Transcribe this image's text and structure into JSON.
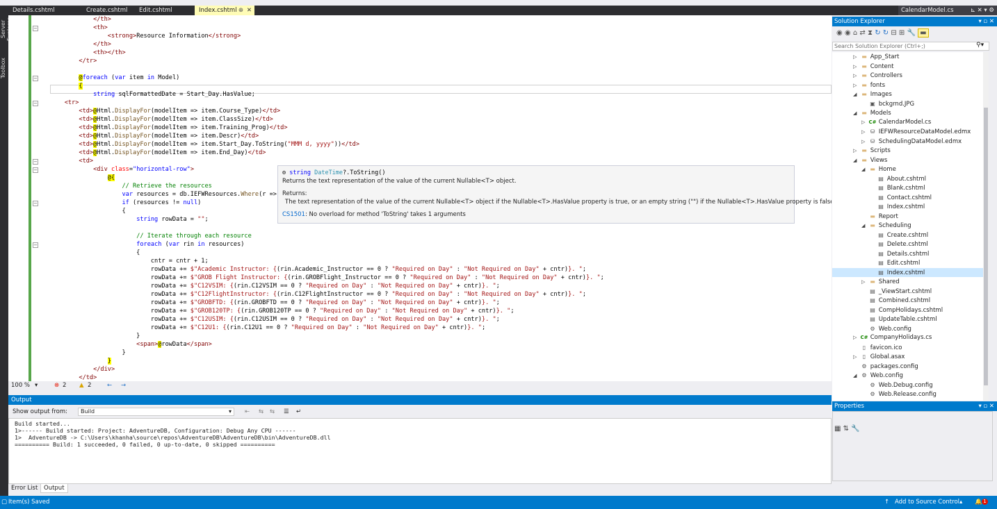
{
  "left_strip": {
    "tabs": [
      "Server Explorer",
      "Toolbox"
    ]
  },
  "tabs": [
    {
      "label": "Details.cshtml",
      "active": false
    },
    {
      "label": "Create.cshtml",
      "active": false
    },
    {
      "label": "Edit.cshtml",
      "active": false
    },
    {
      "label": "Index.cshtml",
      "active": true,
      "pin": "⊕",
      "close": "✕"
    }
  ],
  "right_tab": {
    "label": "CalendarModel.cs",
    "controls": "⊾ ✕ ▾ ⚙"
  },
  "code_lines": [
    [
      {
        "c": "tag",
        "t": "            </th>"
      }
    ],
    [
      {
        "c": "tag",
        "t": "            <th>"
      }
    ],
    [
      {
        "c": "tag",
        "t": "                <strong>"
      },
      {
        "c": "plain",
        "t": "Resource Information"
      },
      {
        "c": "tag",
        "t": "</strong>"
      }
    ],
    [
      {
        "c": "tag",
        "t": "            </th>"
      }
    ],
    [
      {
        "c": "tag",
        "t": "            <th></th>"
      }
    ],
    [
      {
        "c": "tag",
        "t": "        </tr>"
      }
    ],
    [
      {
        "c": "plain",
        "t": ""
      }
    ],
    [
      {
        "c": "plain",
        "t": "        "
      },
      {
        "c": "razor",
        "t": "@"
      },
      {
        "c": "kw",
        "t": "foreach"
      },
      {
        "c": "plain",
        "t": " ("
      },
      {
        "c": "kw",
        "t": "var"
      },
      {
        "c": "plain",
        "t": " item "
      },
      {
        "c": "kw",
        "t": "in"
      },
      {
        "c": "plain",
        "t": " Model)"
      }
    ],
    [
      {
        "c": "plain",
        "t": "        "
      },
      {
        "c": "razor",
        "t": "{"
      }
    ],
    [
      {
        "c": "plain",
        "t": "            "
      },
      {
        "c": "kw",
        "t": "string"
      },
      {
        "c": "plain",
        "t": " sqlFormattedDate = Start_Day.HasValue;"
      }
    ],
    [
      {
        "c": "tag",
        "t": "    <tr>"
      }
    ],
    [
      {
        "c": "tag",
        "t": "        <td>"
      },
      {
        "c": "razor",
        "t": "@"
      },
      {
        "c": "plain",
        "t": "Html."
      },
      {
        "c": "mtd",
        "t": "DisplayFor"
      },
      {
        "c": "plain",
        "t": "(modelItem => item.Course_Type)"
      },
      {
        "c": "tag",
        "t": "</td>"
      }
    ],
    [
      {
        "c": "tag",
        "t": "        <td>"
      },
      {
        "c": "razor",
        "t": "@"
      },
      {
        "c": "plain",
        "t": "Html."
      },
      {
        "c": "mtd",
        "t": "DisplayFor"
      },
      {
        "c": "plain",
        "t": "(modelItem => item.ClassSize)"
      },
      {
        "c": "tag",
        "t": "</td>"
      }
    ],
    [
      {
        "c": "tag",
        "t": "        <td>"
      },
      {
        "c": "razor",
        "t": "@"
      },
      {
        "c": "plain",
        "t": "Html."
      },
      {
        "c": "mtd",
        "t": "DisplayFor"
      },
      {
        "c": "plain",
        "t": "(modelItem => item.Training_Prog)"
      },
      {
        "c": "tag",
        "t": "</td>"
      }
    ],
    [
      {
        "c": "tag",
        "t": "        <td>"
      },
      {
        "c": "razor",
        "t": "@"
      },
      {
        "c": "plain",
        "t": "Html."
      },
      {
        "c": "mtd",
        "t": "DisplayFor"
      },
      {
        "c": "plain",
        "t": "(modelItem => item.Descr)"
      },
      {
        "c": "tag",
        "t": "</td>"
      }
    ],
    [
      {
        "c": "tag",
        "t": "        <td>"
      },
      {
        "c": "razor",
        "t": "@"
      },
      {
        "c": "plain",
        "t": "Html."
      },
      {
        "c": "mtd",
        "t": "DisplayFor"
      },
      {
        "c": "plain",
        "t": "(modelItem => item.Start_Day.ToString("
      },
      {
        "c": "str",
        "t": "\"MMM d, yyyy\""
      },
      {
        "c": "plain",
        "t": "))"
      },
      {
        "c": "tag",
        "t": "</td>"
      }
    ],
    [
      {
        "c": "tag",
        "t": "        <td>"
      },
      {
        "c": "razor",
        "t": "@"
      },
      {
        "c": "plain",
        "t": "Html."
      },
      {
        "c": "mtd",
        "t": "DisplayFor"
      },
      {
        "c": "plain",
        "t": "(modelItem => item.End_Day)"
      },
      {
        "c": "tag",
        "t": "</td>"
      }
    ],
    [
      {
        "c": "tag",
        "t": "        <td>"
      }
    ],
    [
      {
        "c": "tag",
        "t": "            <div "
      },
      {
        "c": "attr",
        "t": "class"
      },
      {
        "c": "plain",
        "t": "="
      },
      {
        "c": "kw",
        "t": "\"horizontal-row\""
      },
      {
        "c": "tag",
        "t": ">"
      }
    ],
    [
      {
        "c": "plain",
        "t": "                "
      },
      {
        "c": "razor",
        "t": "@{"
      }
    ],
    [
      {
        "c": "plain",
        "t": "                    "
      },
      {
        "c": "cmt",
        "t": "// Retrieve the resources"
      }
    ],
    [
      {
        "c": "plain",
        "t": "                    "
      },
      {
        "c": "kw",
        "t": "var"
      },
      {
        "c": "plain",
        "t": " resources = db.IEFWResources."
      },
      {
        "c": "mtd",
        "t": "Where"
      },
      {
        "c": "plain",
        "t": "(r =>"
      }
    ],
    [
      {
        "c": "plain",
        "t": "                    "
      },
      {
        "c": "kw",
        "t": "if"
      },
      {
        "c": "plain",
        "t": " (resources != "
      },
      {
        "c": "kw",
        "t": "null"
      },
      {
        "c": "plain",
        "t": ")"
      }
    ],
    [
      {
        "c": "plain",
        "t": "                    {"
      }
    ],
    [
      {
        "c": "plain",
        "t": "                        "
      },
      {
        "c": "kw",
        "t": "string"
      },
      {
        "c": "plain",
        "t": " rowData = "
      },
      {
        "c": "str",
        "t": "\"\""
      },
      {
        "c": "plain",
        "t": ";"
      }
    ],
    [
      {
        "c": "plain",
        "t": ""
      }
    ],
    [
      {
        "c": "plain",
        "t": "                        "
      },
      {
        "c": "cmt",
        "t": "// Iterate through each resource"
      }
    ],
    [
      {
        "c": "plain",
        "t": "                        "
      },
      {
        "c": "kw",
        "t": "foreach"
      },
      {
        "c": "plain",
        "t": " ("
      },
      {
        "c": "kw",
        "t": "var"
      },
      {
        "c": "plain",
        "t": " rin "
      },
      {
        "c": "kw",
        "t": "in"
      },
      {
        "c": "plain",
        "t": " resources)"
      }
    ],
    [
      {
        "c": "plain",
        "t": "                        {"
      }
    ],
    [
      {
        "c": "plain",
        "t": "                            cntr = cntr + 1;"
      }
    ],
    [
      {
        "c": "plain",
        "t": "                            rowData += "
      },
      {
        "c": "str",
        "t": "$\"Academic Instructor: {"
      },
      {
        "c": "plain",
        "t": "(rin.Academic_Instructor == 0 ? "
      },
      {
        "c": "str",
        "t": "\"Required on Day\""
      },
      {
        "c": "plain",
        "t": " : "
      },
      {
        "c": "str",
        "t": "\"Not Required on Day\""
      },
      {
        "c": "plain",
        "t": " + cntr)"
      },
      {
        "c": "str",
        "t": "}. \""
      },
      {
        "c": "plain",
        "t": ";"
      }
    ],
    [
      {
        "c": "plain",
        "t": "                            rowData += "
      },
      {
        "c": "str",
        "t": "$\"GROB Flight Instructor: {"
      },
      {
        "c": "plain",
        "t": "(rin.GROBFlight_Instructor == 0 ? "
      },
      {
        "c": "str",
        "t": "\"Required on Day\""
      },
      {
        "c": "plain",
        "t": " : "
      },
      {
        "c": "str",
        "t": "\"Not Required on Day\""
      },
      {
        "c": "plain",
        "t": " + cntr)"
      },
      {
        "c": "str",
        "t": "}. \""
      },
      {
        "c": "plain",
        "t": ";"
      }
    ],
    [
      {
        "c": "plain",
        "t": "                            rowData += "
      },
      {
        "c": "str",
        "t": "$\"C12VSIM: {"
      },
      {
        "c": "plain",
        "t": "(rin.C12VSIM == 0 ? "
      },
      {
        "c": "str",
        "t": "\"Required on Day\""
      },
      {
        "c": "plain",
        "t": " : "
      },
      {
        "c": "str",
        "t": "\"Not Required on Day\""
      },
      {
        "c": "plain",
        "t": " + cntr)"
      },
      {
        "c": "str",
        "t": "}. \""
      },
      {
        "c": "plain",
        "t": ";"
      }
    ],
    [
      {
        "c": "plain",
        "t": "                            rowData += "
      },
      {
        "c": "str",
        "t": "$\"C12FlightInstructor: {"
      },
      {
        "c": "plain",
        "t": "(rin.C12FlightInstructor == 0 ? "
      },
      {
        "c": "str",
        "t": "\"Required on Day\""
      },
      {
        "c": "plain",
        "t": " : "
      },
      {
        "c": "str",
        "t": "\"Not Required on Day\""
      },
      {
        "c": "plain",
        "t": " + cntr)"
      },
      {
        "c": "str",
        "t": "}. \""
      },
      {
        "c": "plain",
        "t": ";"
      }
    ],
    [
      {
        "c": "plain",
        "t": "                            rowData += "
      },
      {
        "c": "str",
        "t": "$\"GROBFTD: {"
      },
      {
        "c": "plain",
        "t": "(rin.GROBFTD == 0 ? "
      },
      {
        "c": "str",
        "t": "\"Required on Day\""
      },
      {
        "c": "plain",
        "t": " : "
      },
      {
        "c": "str",
        "t": "\"Not Required on Day\""
      },
      {
        "c": "plain",
        "t": " + cntr)"
      },
      {
        "c": "str",
        "t": "}. \""
      },
      {
        "c": "plain",
        "t": ";"
      }
    ],
    [
      {
        "c": "plain",
        "t": "                            rowData += "
      },
      {
        "c": "str",
        "t": "$\"GROB120TP: {"
      },
      {
        "c": "plain",
        "t": "(rin.GROB120TP == 0 ? "
      },
      {
        "c": "str",
        "t": "\"Required on Day\""
      },
      {
        "c": "plain",
        "t": " : "
      },
      {
        "c": "str",
        "t": "\"Not Required on Day\""
      },
      {
        "c": "plain",
        "t": " + cntr)"
      },
      {
        "c": "str",
        "t": "}. \""
      },
      {
        "c": "plain",
        "t": ";"
      }
    ],
    [
      {
        "c": "plain",
        "t": "                            rowData += "
      },
      {
        "c": "str",
        "t": "$\"C12USIM: {"
      },
      {
        "c": "plain",
        "t": "(rin.C12USIM == 0 ? "
      },
      {
        "c": "str",
        "t": "\"Required on Day\""
      },
      {
        "c": "plain",
        "t": " : "
      },
      {
        "c": "str",
        "t": "\"Not Required on Day\""
      },
      {
        "c": "plain",
        "t": " + cntr)"
      },
      {
        "c": "str",
        "t": "}. \""
      },
      {
        "c": "plain",
        "t": ";"
      }
    ],
    [
      {
        "c": "plain",
        "t": "                            rowData += "
      },
      {
        "c": "str",
        "t": "$\"C12U1: {"
      },
      {
        "c": "plain",
        "t": "(rin.C12U1 == 0 ? "
      },
      {
        "c": "str",
        "t": "\"Required on Day\""
      },
      {
        "c": "plain",
        "t": " : "
      },
      {
        "c": "str",
        "t": "\"Not Required on Day\""
      },
      {
        "c": "plain",
        "t": " + cntr)"
      },
      {
        "c": "str",
        "t": "}. \""
      },
      {
        "c": "plain",
        "t": ";"
      }
    ],
    [
      {
        "c": "plain",
        "t": "                        }"
      }
    ],
    [
      {
        "c": "tag",
        "t": "                        <span>"
      },
      {
        "c": "razor",
        "t": "@"
      },
      {
        "c": "plain",
        "t": "rowData"
      },
      {
        "c": "tag",
        "t": "</span>"
      }
    ],
    [
      {
        "c": "plain",
        "t": "                    }"
      }
    ],
    [
      {
        "c": "plain",
        "t": "                "
      },
      {
        "c": "razor",
        "t": "}"
      }
    ],
    [
      {
        "c": "tag",
        "t": "            </div>"
      }
    ],
    [
      {
        "c": "tag",
        "t": "        </td>"
      }
    ]
  ],
  "tooltip": {
    "line1": [
      {
        "c": "icon",
        "t": "⚙ "
      },
      {
        "c": "kw",
        "t": "string"
      },
      {
        "c": "plain",
        "t": " "
      },
      {
        "c": "type",
        "t": "DateTime"
      },
      {
        "c": "plain",
        "t": "?.ToString()"
      }
    ],
    "line2": "Returns the text representation of the value of the current Nullable<T> object.",
    "returns_label": "Returns:",
    "returns_text": "The text representation of the value of the current Nullable<T> object if the Nullable<T>.HasValue property is true, or an empty string (\"\") if the Nullable<T>.HasValue property is false.",
    "error_code": "CS1501",
    "error_text": ": No overload for method 'ToString' takes 1 arguments"
  },
  "editor_status": {
    "zoom": "100 %",
    "errors": "2",
    "warnings": "2"
  },
  "output": {
    "title": "Output",
    "show_from_label": "Show output from:",
    "source": "Build",
    "lines": [
      "Build started...",
      "1>------ Build started: Project: AdventureDB, Configuration: Debug Any CPU ------",
      "1>  AdventureDB -> C:\\Users\\khanha\\source\\repos\\AdventureDB\\AdventureDB\\bin\\AdventureDB.dll",
      "========== Build: 1 succeeded, 0 failed, 0 up-to-date, 0 skipped =========="
    ]
  },
  "bottom_tabs": [
    "Error List",
    "Output"
  ],
  "status_bar": {
    "left": "Item(s) Saved",
    "add_source": "Add to Source Control",
    "notifications": "1"
  },
  "solution_explorer": {
    "title": "Solution Explorer",
    "search_placeholder": "Search Solution Explorer (Ctrl+;)",
    "nodes": [
      {
        "label": "App_Start",
        "indent": 1,
        "arrow": "▷",
        "icon": "folder"
      },
      {
        "label": "Content",
        "indent": 1,
        "arrow": "▷",
        "icon": "folder"
      },
      {
        "label": "Controllers",
        "indent": 1,
        "arrow": "▷",
        "icon": "folder"
      },
      {
        "label": "fonts",
        "indent": 1,
        "arrow": "▷",
        "icon": "folder"
      },
      {
        "label": "Images",
        "indent": 1,
        "arrow": "◢",
        "icon": "folder"
      },
      {
        "label": "bckgrnd.JPG",
        "indent": 2,
        "arrow": "",
        "icon": "image"
      },
      {
        "label": "Models",
        "indent": 1,
        "arrow": "◢",
        "icon": "folder"
      },
      {
        "label": "CalendarModel.cs",
        "indent": 2,
        "arrow": "▷",
        "icon": "cs"
      },
      {
        "label": "IEFWResourceDataModel.edmx",
        "indent": 2,
        "arrow": "▷",
        "icon": "edmx"
      },
      {
        "label": "SchedulingDataModel.edmx",
        "indent": 2,
        "arrow": "▷",
        "icon": "edmx"
      },
      {
        "label": "Scripts",
        "indent": 1,
        "arrow": "▷",
        "icon": "folder"
      },
      {
        "label": "Views",
        "indent": 1,
        "arrow": "◢",
        "icon": "folder"
      },
      {
        "label": "Home",
        "indent": 2,
        "arrow": "◢",
        "icon": "folder"
      },
      {
        "label": "About.cshtml",
        "indent": 3,
        "arrow": "",
        "icon": "cshtml"
      },
      {
        "label": "Blank.cshtml",
        "indent": 3,
        "arrow": "",
        "icon": "cshtml"
      },
      {
        "label": "Contact.cshtml",
        "indent": 3,
        "arrow": "",
        "icon": "cshtml"
      },
      {
        "label": "Index.cshtml",
        "indent": 3,
        "arrow": "",
        "icon": "cshtml"
      },
      {
        "label": "Report",
        "indent": 2,
        "arrow": "",
        "icon": "folder"
      },
      {
        "label": "Scheduling",
        "indent": 2,
        "arrow": "◢",
        "icon": "folder"
      },
      {
        "label": "Create.cshtml",
        "indent": 3,
        "arrow": "",
        "icon": "cshtml"
      },
      {
        "label": "Delete.cshtml",
        "indent": 3,
        "arrow": "",
        "icon": "cshtml"
      },
      {
        "label": "Details.cshtml",
        "indent": 3,
        "arrow": "",
        "icon": "cshtml"
      },
      {
        "label": "Edit.cshtml",
        "indent": 3,
        "arrow": "",
        "icon": "cshtml"
      },
      {
        "label": "Index.cshtml",
        "indent": 3,
        "arrow": "",
        "icon": "cshtml",
        "selected": true
      },
      {
        "label": "Shared",
        "indent": 2,
        "arrow": "▷",
        "icon": "folder"
      },
      {
        "label": "_ViewStart.cshtml",
        "indent": 2,
        "arrow": "",
        "icon": "cshtml"
      },
      {
        "label": "Combined.cshtml",
        "indent": 2,
        "arrow": "",
        "icon": "cshtml"
      },
      {
        "label": "CompHolidays.cshtml",
        "indent": 2,
        "arrow": "",
        "icon": "cshtml"
      },
      {
        "label": "UpdateTable.cshtml",
        "indent": 2,
        "arrow": "",
        "icon": "cshtml"
      },
      {
        "label": "Web.config",
        "indent": 2,
        "arrow": "",
        "icon": "config"
      },
      {
        "label": "CompanyHolidays.cs",
        "indent": 1,
        "arrow": "▷",
        "icon": "cs"
      },
      {
        "label": "favicon.ico",
        "indent": 1,
        "arrow": "",
        "icon": "file"
      },
      {
        "label": "Global.asax",
        "indent": 1,
        "arrow": "▷",
        "icon": "file"
      },
      {
        "label": "packages.config",
        "indent": 1,
        "arrow": "",
        "icon": "config"
      },
      {
        "label": "Web.config",
        "indent": 1,
        "arrow": "◢",
        "icon": "config"
      },
      {
        "label": "Web.Debug.config",
        "indent": 2,
        "arrow": "",
        "icon": "config"
      },
      {
        "label": "Web.Release.config",
        "indent": 2,
        "arrow": "",
        "icon": "config"
      }
    ]
  },
  "properties": {
    "title": "Properties"
  },
  "colors": {
    "accent": "#007acc",
    "active_tab": "#fffcb6",
    "selection": "#cce8ff"
  }
}
